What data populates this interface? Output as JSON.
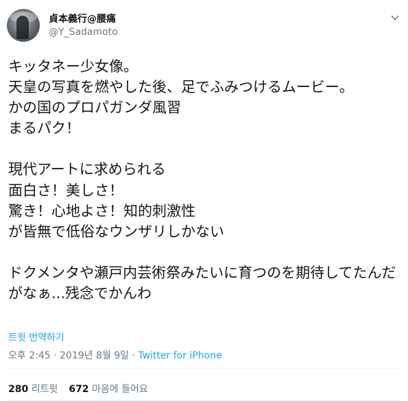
{
  "header": {
    "display_name": "貞本義行@腰痛",
    "handle": "@Y_Sadamoto"
  },
  "tweet": {
    "text": "キッタネー少女像。\n天皇の写真を燃やした後、足でふみつけるムービー。\nかの国のプロパガンダ風習\nまるパク！\n\n現代アートに求められる\n面白さ！美しさ！\n驚き！心地よさ！知的刺激性\nが皆無で低俗なウンザリしかない\n\nドクメンタや瀬戸内芸術祭みたいに育つのを期待してたんだがなぁ...残念でかんわ",
    "translate_label": "트윗 번역하기"
  },
  "meta": {
    "time": "오후 2:45",
    "separator": " · ",
    "date": "2019년 8월 9일",
    "source": "Twitter for iPhone"
  },
  "stats": {
    "retweets_count": "280",
    "retweets_label": "리트윗",
    "likes_count": "672",
    "likes_label": "마음에 들어요"
  },
  "icons": {
    "avatar": "profile-avatar",
    "menu": "chevron-down-icon"
  },
  "colors": {
    "link": "#1da1f2",
    "secondary_text": "#657786",
    "divider": "#e6ecf0"
  }
}
